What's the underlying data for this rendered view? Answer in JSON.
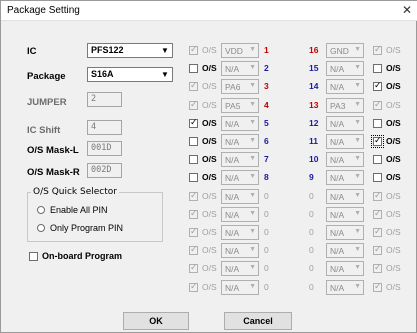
{
  "window": {
    "title": "Package Setting",
    "close_glyph": "✕"
  },
  "left": {
    "ic_label": "IC",
    "ic_value": "PFS122",
    "package_label": "Package",
    "package_value": "S16A",
    "jumper_label": "JUMPER",
    "jumper_value": "2",
    "icshift_label": "IC Shift",
    "icshift_value": "4",
    "maskl_label": "O/S Mask-L",
    "maskl_value": "001D",
    "maskr_label": "O/S Mask-R",
    "maskr_value": "002D",
    "quick_selector_title": "O/S Quick Selector",
    "enable_all": "Enable All PIN",
    "only_program": "Only Program PIN",
    "onboard": "On-board Program"
  },
  "pin_left": [
    {
      "os_label": "O/S",
      "enabled": false,
      "checked": true,
      "pin": "VDD",
      "pin_enabled": false,
      "num": "1",
      "num_style": "red"
    },
    {
      "os_label": "O/S",
      "enabled": true,
      "checked": false,
      "pin": "N/A",
      "pin_enabled": false,
      "num": "2",
      "num_style": "blue"
    },
    {
      "os_label": "O/S",
      "enabled": false,
      "checked": true,
      "pin": "PA6",
      "pin_enabled": false,
      "num": "3",
      "num_style": "red"
    },
    {
      "os_label": "O/S",
      "enabled": false,
      "checked": true,
      "pin": "PA5",
      "pin_enabled": false,
      "num": "4",
      "num_style": "red"
    },
    {
      "os_label": "O/S",
      "enabled": true,
      "checked": true,
      "pin": "N/A",
      "pin_enabled": false,
      "num": "5",
      "num_style": "blue"
    },
    {
      "os_label": "O/S",
      "enabled": true,
      "checked": false,
      "pin": "N/A",
      "pin_enabled": false,
      "num": "6",
      "num_style": "blue"
    },
    {
      "os_label": "O/S",
      "enabled": true,
      "checked": false,
      "pin": "N/A",
      "pin_enabled": false,
      "num": "7",
      "num_style": "blue"
    },
    {
      "os_label": "O/S",
      "enabled": true,
      "checked": false,
      "pin": "N/A",
      "pin_enabled": false,
      "num": "8",
      "num_style": "blue"
    },
    {
      "os_label": "O/S",
      "enabled": false,
      "checked": true,
      "pin": "N/A",
      "pin_enabled": false,
      "num": "0",
      "num_style": "gray"
    },
    {
      "os_label": "O/S",
      "enabled": false,
      "checked": true,
      "pin": "N/A",
      "pin_enabled": false,
      "num": "0",
      "num_style": "gray"
    },
    {
      "os_label": "O/S",
      "enabled": false,
      "checked": true,
      "pin": "N/A",
      "pin_enabled": false,
      "num": "0",
      "num_style": "gray"
    },
    {
      "os_label": "O/S",
      "enabled": false,
      "checked": true,
      "pin": "N/A",
      "pin_enabled": false,
      "num": "0",
      "num_style": "gray"
    },
    {
      "os_label": "O/S",
      "enabled": false,
      "checked": true,
      "pin": "N/A",
      "pin_enabled": false,
      "num": "0",
      "num_style": "gray"
    },
    {
      "os_label": "O/S",
      "enabled": false,
      "checked": true,
      "pin": "N/A",
      "pin_enabled": false,
      "num": "0",
      "num_style": "gray"
    }
  ],
  "pin_right": [
    {
      "num": "16",
      "num_style": "red",
      "pin": "GND",
      "os_label": "O/S",
      "enabled": false,
      "checked": true
    },
    {
      "num": "15",
      "num_style": "blue",
      "pin": "N/A",
      "os_label": "O/S",
      "enabled": true,
      "checked": false
    },
    {
      "num": "14",
      "num_style": "blue",
      "pin": "N/A",
      "os_label": "O/S",
      "enabled": true,
      "checked": true
    },
    {
      "num": "13",
      "num_style": "red",
      "pin": "PA3",
      "os_label": "O/S",
      "enabled": false,
      "checked": true
    },
    {
      "num": "12",
      "num_style": "blue",
      "pin": "N/A",
      "os_label": "O/S",
      "enabled": true,
      "checked": false
    },
    {
      "num": "11",
      "num_style": "blue",
      "pin": "N/A",
      "os_label": "O/S",
      "enabled": true,
      "checked": true,
      "focused": true
    },
    {
      "num": "10",
      "num_style": "blue",
      "pin": "N/A",
      "os_label": "O/S",
      "enabled": true,
      "checked": false
    },
    {
      "num": "9",
      "num_style": "blue",
      "pin": "N/A",
      "os_label": "O/S",
      "enabled": true,
      "checked": false
    },
    {
      "num": "0",
      "num_style": "gray",
      "pin": "N/A",
      "os_label": "O/S",
      "enabled": false,
      "checked": true
    },
    {
      "num": "0",
      "num_style": "gray",
      "pin": "N/A",
      "os_label": "O/S",
      "enabled": false,
      "checked": true
    },
    {
      "num": "0",
      "num_style": "gray",
      "pin": "N/A",
      "os_label": "O/S",
      "enabled": false,
      "checked": true
    },
    {
      "num": "0",
      "num_style": "gray",
      "pin": "N/A",
      "os_label": "O/S",
      "enabled": false,
      "checked": true
    },
    {
      "num": "0",
      "num_style": "gray",
      "pin": "N/A",
      "os_label": "O/S",
      "enabled": false,
      "checked": true
    },
    {
      "num": "0",
      "num_style": "gray",
      "pin": "N/A",
      "os_label": "O/S",
      "enabled": false,
      "checked": true
    }
  ],
  "buttons": {
    "ok": "OK",
    "cancel": "Cancel"
  },
  "glyphs": {
    "check": "✓",
    "dropdown": "▼"
  }
}
